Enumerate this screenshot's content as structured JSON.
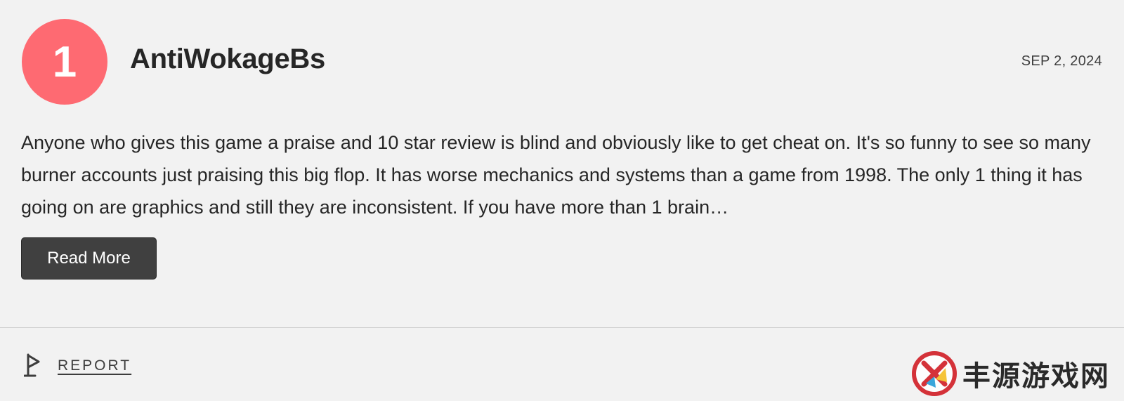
{
  "review": {
    "score": "1",
    "username": "AntiWokageBs",
    "date": "SEP 2, 2024",
    "body": "Anyone who gives this game a praise and 10 star review is blind and obviously like to get cheat on. It's so funny to see so many burner accounts just praising this big flop. It has worse mechanics and systems than a game from 1998. The only 1 thing it has going on are graphics and still they are inconsistent. If you have more than 1 brain…",
    "read_more_label": "Read More",
    "report_label": "REPORT"
  },
  "watermark": {
    "text": "丰源游戏网",
    "logo_icon": "red-circle-logo-icon"
  },
  "colors": {
    "background": "#f2f2f2",
    "score_badge": "#fe6a72",
    "button_bg": "#404040",
    "text": "#262626"
  }
}
